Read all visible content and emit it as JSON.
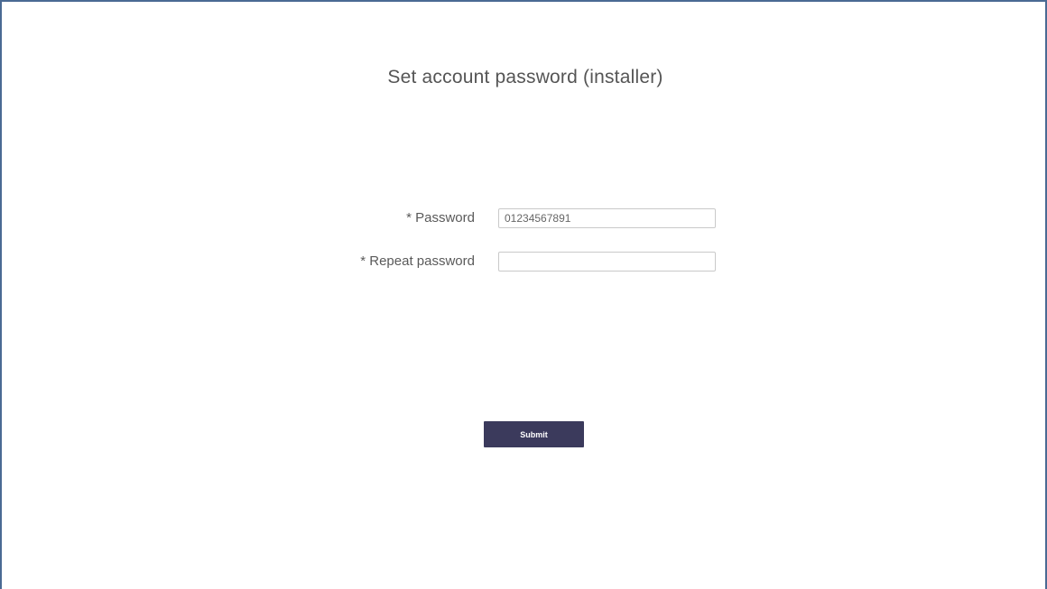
{
  "page": {
    "title": "Set account password (installer)"
  },
  "form": {
    "password": {
      "label": "* Password",
      "value": "01234567891",
      "placeholder": ""
    },
    "repeat_password": {
      "label": "* Repeat password",
      "value": "",
      "placeholder": ""
    },
    "submit_label": "Submit"
  },
  "colors": {
    "frame_border": "#4a6a93",
    "button_background": "#3b3a5c",
    "button_text": "#ffffff",
    "label_text": "#5a5a5a"
  }
}
